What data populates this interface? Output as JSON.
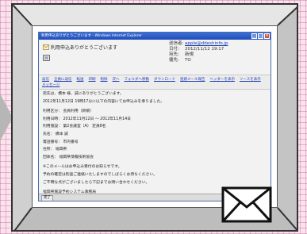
{
  "window": {
    "title": "利用申込ありがとうございます - Windows Internet Explorer",
    "buttons": {
      "minimize": "_",
      "maximize": "□",
      "close": "×"
    }
  },
  "mail": {
    "subject": "利用申込ありがとうございます",
    "meta": [
      {
        "key": "送信者:",
        "value": "apple@ddeshinfo.jp",
        "is_link": true
      },
      {
        "key": "日付:",
        "value": "2012/11/12 19:17",
        "is_link": false
      },
      {
        "key": "宛先:",
        "value": "新規",
        "is_link": false
      },
      {
        "key": "優先:",
        "value": "TO",
        "is_link": false
      }
    ]
  },
  "links": [
    "返信",
    "全員に返信",
    "転送",
    "印刷",
    "削除",
    "次へ",
    "フォルダへ移動",
    "ダウンロード",
    "迷惑メール報告",
    "ヘッダーを表示",
    "ソースを表示",
    "メッセージ"
  ],
  "body": {
    "lines": [
      "宛先は、橋本 様、誠にありがとうございます。",
      "2012年11月12日 19時17分に以下の内容にてお申込みを承りました。",
      "",
      "利用区分：   会員利用（新規）",
      "利用日時：   2012年11月12日 〜 2012年11月14日",
      "利用施設：   第2会議室（A） 定員8名",
      "氏名：       橋本 誠",
      "電話番号：   市内番号",
      "住所：       福岡県",
      "団体名：     福岡県情報技術協会",
      "",
      "※このメールはお申込み受付のお知らせです。",
      "予約の確定は別途ご連絡いたしますのでしばらくお待ちください。",
      "ご不明な点がございましたら下記までお問い合わせください。",
      "",
      "福岡県施設予約システム事務局"
    ]
  },
  "status": {
    "label": "完了"
  },
  "colors": {
    "background_pink": "#fbe3ee",
    "grid_line": "#c86ea0",
    "frame_gray": "#d9d9d9",
    "titlebar_blue": "#2f5fd0",
    "link_blue": "#1a3bb5"
  },
  "icons": [
    "mail-app-icon",
    "message-tool-icon",
    "envelope-icon",
    "left-arrow-icon"
  ]
}
